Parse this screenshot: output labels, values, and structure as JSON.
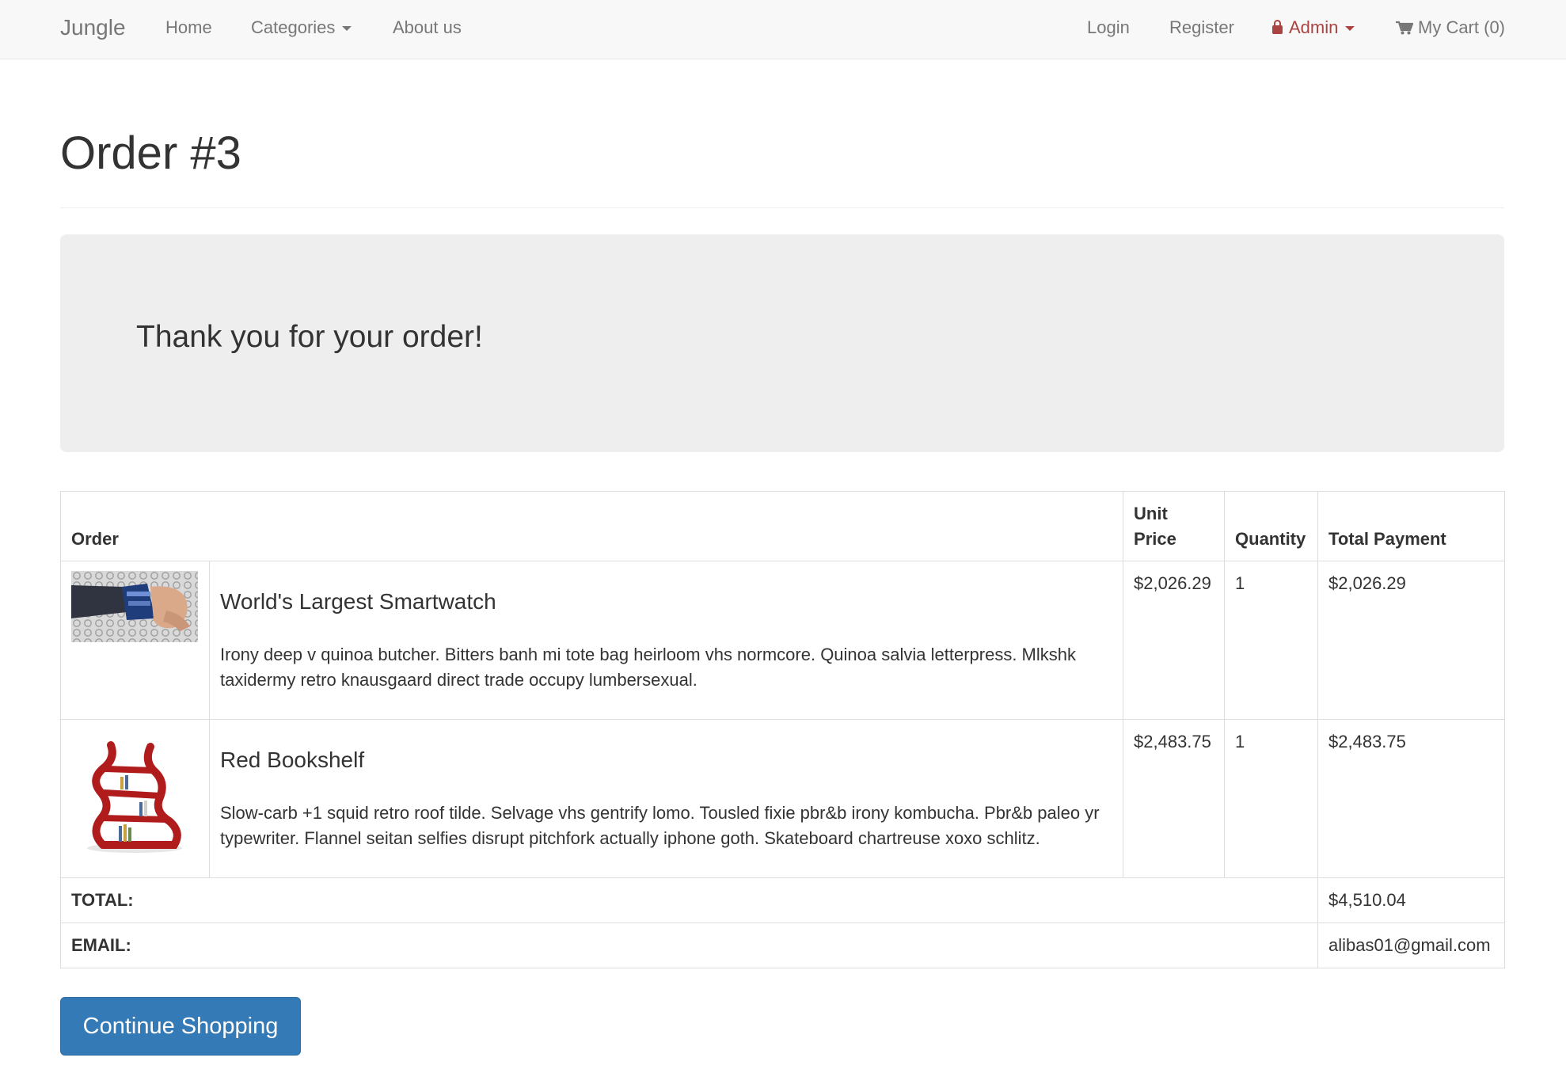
{
  "navbar": {
    "brand": "Jungle",
    "home": "Home",
    "categories": "Categories",
    "about": "About us",
    "login": "Login",
    "register": "Register",
    "admin": "Admin",
    "cart": "My Cart (0)"
  },
  "page": {
    "title": "Order #3"
  },
  "jumbotron": {
    "message": "Thank you for your order!"
  },
  "table": {
    "headers": {
      "order": "Order",
      "unit_price": "Unit Price",
      "quantity": "Quantity",
      "total_payment": "Total Payment"
    },
    "items": [
      {
        "name": "World's Largest Smartwatch",
        "description": "Irony deep v quinoa butcher. Bitters banh mi tote bag heirloom vhs normcore. Quinoa salvia letterpress. Mlkshk taxidermy retro knausgaard direct trade occupy lumbersexual.",
        "unit_price": "$2,026.29",
        "quantity": "1",
        "total": "$2,026.29"
      },
      {
        "name": "Red Bookshelf",
        "description": "Slow-carb +1 squid retro roof tilde. Selvage vhs gentrify lomo. Tousled fixie pbr&b irony kombucha. Pbr&b paleo yr typewriter. Flannel seitan selfies disrupt pitchfork actually iphone goth. Skateboard chartreuse xoxo schlitz.",
        "unit_price": "$2,483.75",
        "quantity": "1",
        "total": "$2,483.75"
      }
    ],
    "total_label": "TOTAL:",
    "total_value": "$4,510.04",
    "email_label": "EMAIL:",
    "email_value": "alibas01@gmail.com"
  },
  "actions": {
    "continue_shopping": "Continue Shopping"
  },
  "colors": {
    "primary_button": "#337ab7",
    "admin_link": "#a94442",
    "navbar_bg": "#f8f8f8",
    "jumbotron_bg": "#eeeeee"
  }
}
